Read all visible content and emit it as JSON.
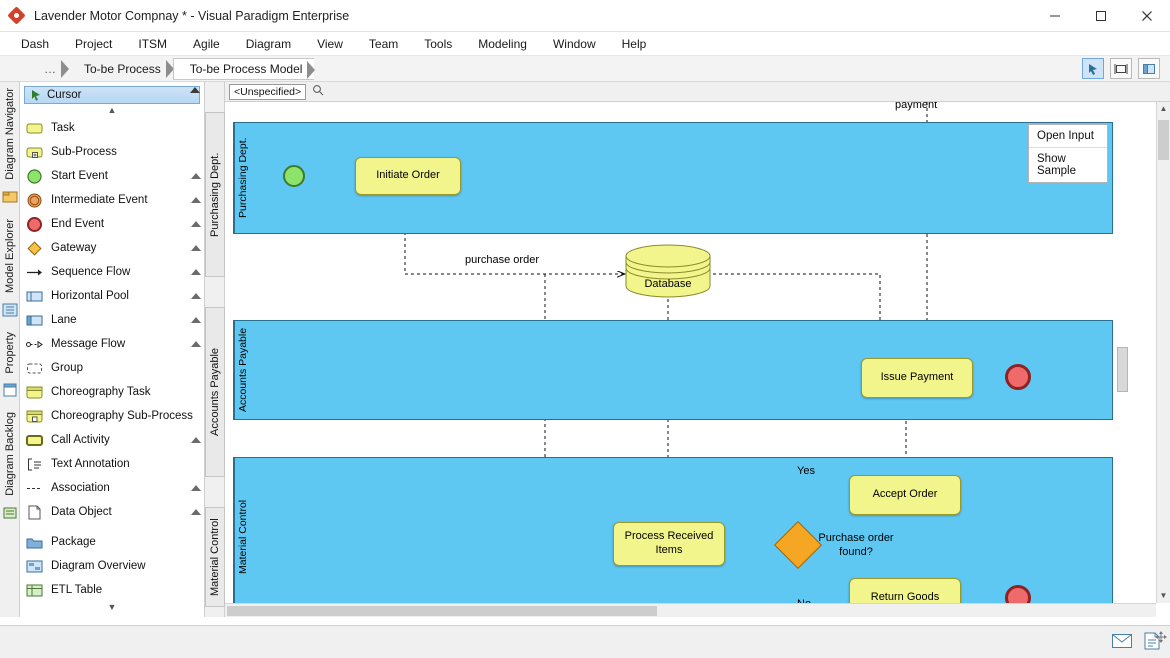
{
  "window": {
    "title": "Lavender Motor Compnay * - Visual Paradigm Enterprise",
    "minimize": "─",
    "maximize": "☐",
    "close": "✕"
  },
  "menu": [
    "Dash",
    "Project",
    "ITSM",
    "Agile",
    "Diagram",
    "View",
    "Team",
    "Tools",
    "Modeling",
    "Window",
    "Help"
  ],
  "breadcrumb": {
    "items": [
      "…",
      "To-be Process",
      "To-be Process Model"
    ],
    "icons": [
      "pointer-icon",
      "frame-icon",
      "layers-icon"
    ]
  },
  "left_tabs": [
    {
      "label": "Diagram Navigator",
      "icon": "navigator-icon"
    },
    {
      "label": "Model Explorer",
      "icon": "explorer-icon"
    },
    {
      "label": "Property",
      "icon": "property-icon"
    },
    {
      "label": "Diagram Backlog",
      "icon": "backlog-icon"
    }
  ],
  "palette": {
    "cursor": "Cursor",
    "items": [
      {
        "label": "Task",
        "icon": "task-icon",
        "marker": false
      },
      {
        "label": "Sub-Process",
        "icon": "subprocess-icon",
        "marker": false
      },
      {
        "label": "Start Event",
        "icon": "start-event-icon",
        "marker": true
      },
      {
        "label": "Intermediate Event",
        "icon": "intermediate-event-icon",
        "marker": true
      },
      {
        "label": "End Event",
        "icon": "end-event-icon",
        "marker": true
      },
      {
        "label": "Gateway",
        "icon": "gateway-icon",
        "marker": true
      },
      {
        "label": "Sequence Flow",
        "icon": "sequence-flow-icon",
        "marker": true
      },
      {
        "label": "Horizontal Pool",
        "icon": "horizontal-pool-icon",
        "marker": true
      },
      {
        "label": "Lane",
        "icon": "lane-icon",
        "marker": true
      },
      {
        "label": "Message Flow",
        "icon": "message-flow-icon",
        "marker": true
      },
      {
        "label": "Group",
        "icon": "group-icon",
        "marker": false
      },
      {
        "label": "Choreography Task",
        "icon": "choreography-task-icon",
        "marker": false
      },
      {
        "label": "Choreography Sub-Process",
        "icon": "choreography-subprocess-icon",
        "marker": false
      },
      {
        "label": "Call Activity",
        "icon": "call-activity-icon",
        "marker": true
      },
      {
        "label": "Text Annotation",
        "icon": "text-annotation-icon",
        "marker": false
      },
      {
        "label": "Association",
        "icon": "association-icon",
        "marker": true
      },
      {
        "label": "Data Object",
        "icon": "data-object-icon",
        "marker": true
      }
    ],
    "items2": [
      {
        "label": "Package",
        "icon": "package-icon"
      },
      {
        "label": "Diagram Overview",
        "icon": "diagram-overview-icon"
      },
      {
        "label": "ETL Table",
        "icon": "etl-table-icon"
      }
    ],
    "scroll_up": "▲",
    "scroll_down": "▼"
  },
  "canvas_header": {
    "unspecified": "<Unspecified>",
    "search_icon": "search-icon"
  },
  "popup": {
    "items": [
      "Open Input",
      "Show Sample"
    ]
  },
  "lane_strip": [
    {
      "label": "Purchasing Dept."
    },
    {
      "label": "Accounts Payable"
    },
    {
      "label": "Material Control"
    }
  ],
  "diagram": {
    "pools": [
      {
        "name": "Purchasing Dept."
      },
      {
        "name": "Accounts Payable"
      },
      {
        "name": "Material Control"
      }
    ],
    "tasks": [
      {
        "name": "Initiate Order"
      },
      {
        "name": "Issue Payment"
      },
      {
        "name": "Accept Order"
      },
      {
        "name": "Process Received Items"
      },
      {
        "name": "Return Goods"
      }
    ],
    "datastore": "Database",
    "gateway": "Purchase order found?",
    "labels": {
      "payment": "payment",
      "purchase_order": "purchase order",
      "yes": "Yes",
      "no": "No"
    }
  },
  "status": {
    "mail_icon": "mail-icon",
    "doc_icon": "document-icon"
  }
}
